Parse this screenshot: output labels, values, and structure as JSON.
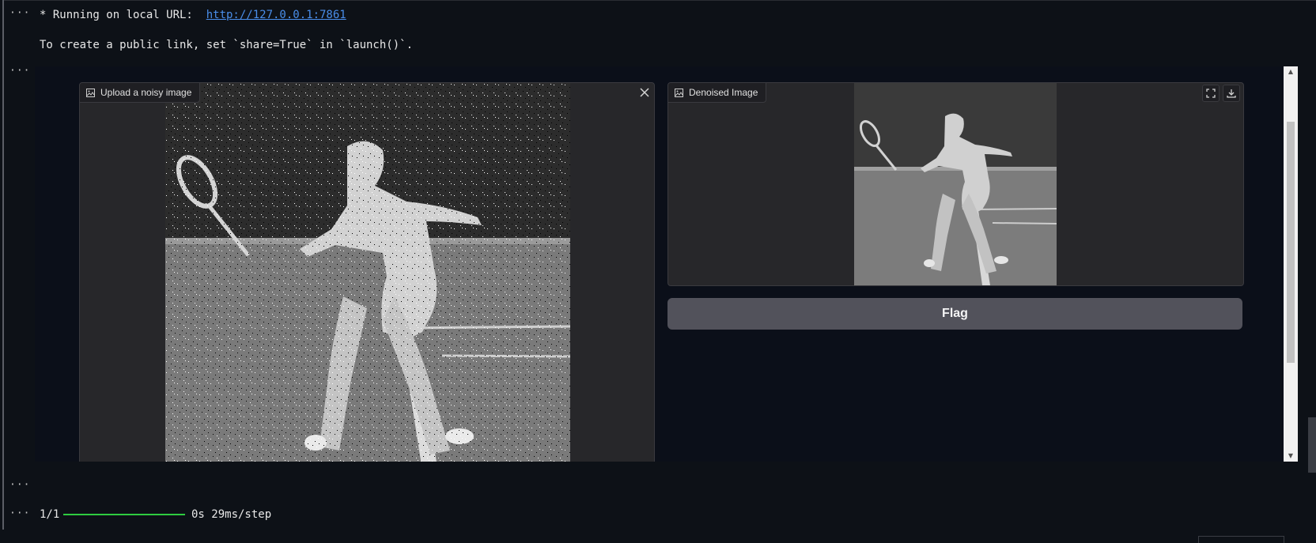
{
  "cell_outputs": {
    "ellipsis": "···",
    "running_prefix": "* Running on local URL:  ",
    "local_url": "http://127.0.0.1:7861",
    "public_link_text": "To create a public link, set `share=True` in `launch()`.",
    "progress_count": "1/1",
    "progress_stats": "0s 29ms/step"
  },
  "gradio": {
    "input_label": "Upload a noisy image",
    "output_label": "Denoised Image",
    "flag_label": "Flag",
    "icons": {
      "input_label_icon": "image-icon",
      "clear": "close-icon",
      "fullscreen": "fullscreen-icon",
      "download": "download-icon"
    }
  },
  "colors": {
    "page_bg": "#0d1117",
    "panel_bg": "#27272a",
    "button_bg": "#52525b",
    "link": "#4a8eea",
    "progress": "#2ecc40"
  }
}
